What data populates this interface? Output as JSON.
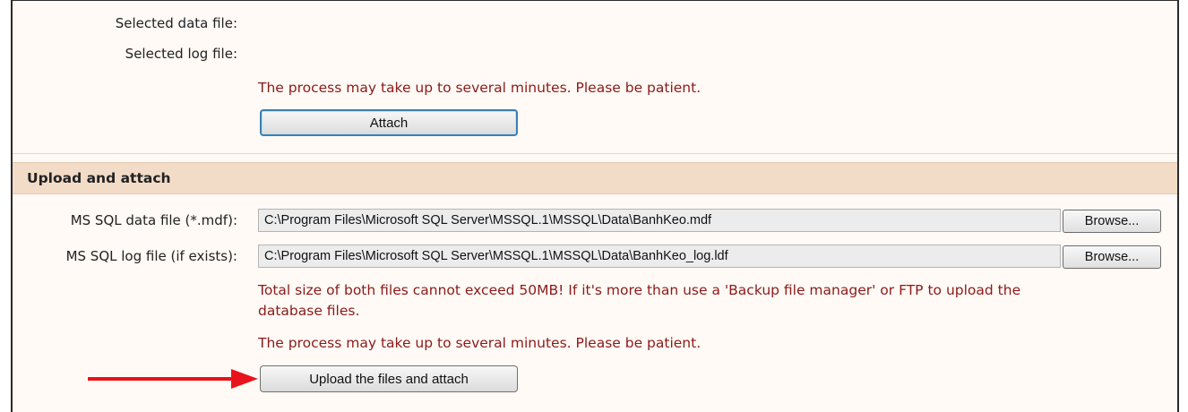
{
  "attach_section": {
    "selected_data_label": "Selected data file:",
    "selected_log_label": "Selected log file:",
    "patience_note": "The process may take up to several minutes. Please be patient.",
    "attach_button": "Attach"
  },
  "upload_section": {
    "title": "Upload and attach",
    "data_file_label": "MS SQL data file (*.mdf):",
    "data_file_value": "C:\\Program Files\\Microsoft SQL Server\\MSSQL.1\\MSSQL\\Data\\BanhKeo.mdf",
    "log_file_label": "MS SQL log file (if exists):",
    "log_file_value": "C:\\Program Files\\Microsoft SQL Server\\MSSQL.1\\MSSQL\\Data\\BanhKeo_log.ldf",
    "browse_label": "Browse...",
    "size_note_line1": "Total size of both files cannot exceed 50MB! If it's more than use a 'Backup file manager' or FTP to upload the",
    "size_note_line2": "database files.",
    "patience_note": "The process may take up to several minutes. Please be patient.",
    "upload_button": "Upload the files and attach"
  },
  "colors": {
    "panel_bg": "#fffaf5",
    "section_header_bg": "#f2dcc8",
    "note_text": "#8b1a1a",
    "arrow": "#e8141b",
    "focus_border": "#3c7fb1"
  },
  "icons": {
    "annotation": "red-arrow-right-icon"
  }
}
